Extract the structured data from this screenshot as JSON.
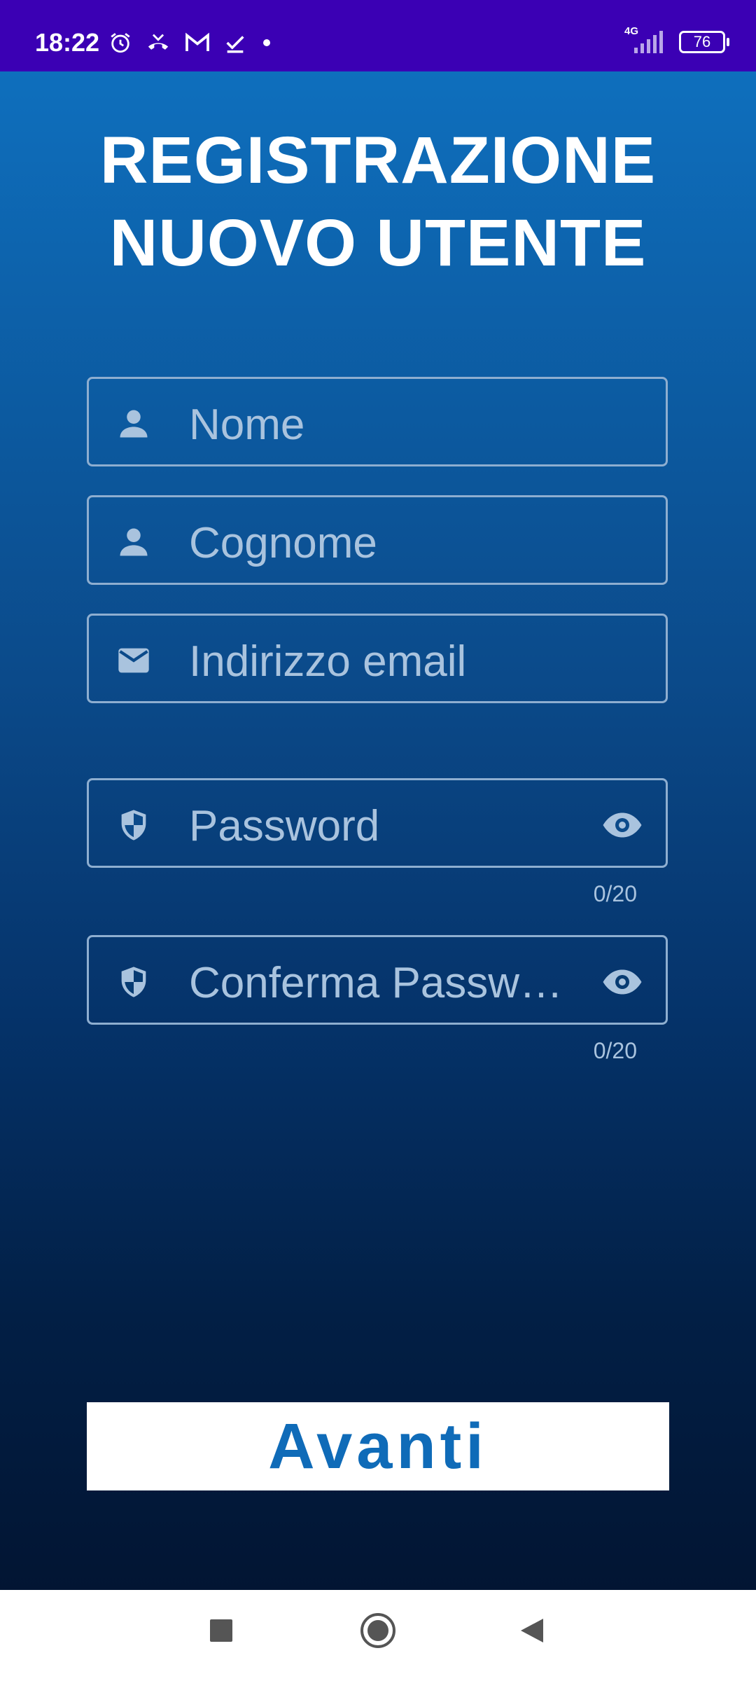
{
  "status_bar": {
    "time": "18:22",
    "network": "4G",
    "battery": "76"
  },
  "title": {
    "line1": "REGISTRAZIONE",
    "line2": "NUOVO UTENTE"
  },
  "form": {
    "first_name_placeholder": "Nome",
    "last_name_placeholder": "Cognome",
    "email_placeholder": "Indirizzo email",
    "password_placeholder": "Password",
    "password_counter": "0/20",
    "confirm_password_placeholder": "Conferma Passw…",
    "confirm_password_counter": "0/20"
  },
  "next_button": {
    "label": "Avanti"
  },
  "colors": {
    "status_bar": "#3b00b4",
    "background_top": "#0e6fbd",
    "background_bottom": "#021533",
    "field_border": "#8eaed0",
    "placeholder": "#a9c3de",
    "button_text": "#0f6bb8"
  }
}
